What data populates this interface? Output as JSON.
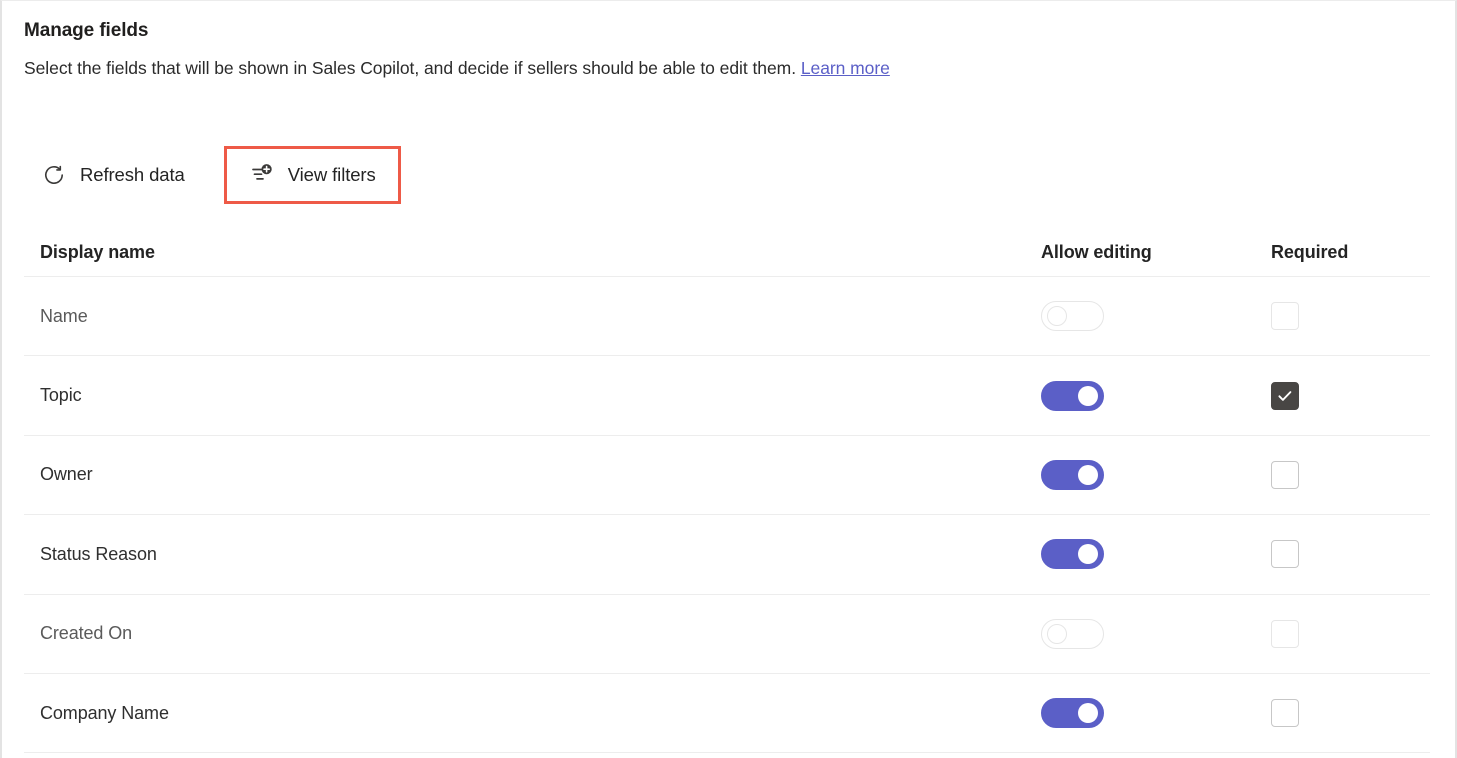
{
  "header": {
    "title": "Manage fields",
    "description_before_link": "Select the fields that will be shown in Sales Copilot, and decide if sellers should be able to edit them. ",
    "link_label": "Learn more"
  },
  "toolbar": {
    "refresh_label": "Refresh data",
    "refresh_icon": "refresh-icon",
    "view_filters_label": "View filters",
    "view_filters_icon": "filter-add-icon",
    "highlight_color": "#ee5a47"
  },
  "table": {
    "columns": [
      {
        "key": "display_name",
        "label": "Display name"
      },
      {
        "key": "allow_editing",
        "label": "Allow editing"
      },
      {
        "key": "required",
        "label": "Required"
      }
    ],
    "rows": [
      {
        "display_name": "Name",
        "allow_editing": "off",
        "required": "unchecked",
        "disabled": true
      },
      {
        "display_name": "Topic",
        "allow_editing": "on",
        "required": "checked",
        "disabled": false
      },
      {
        "display_name": "Owner",
        "allow_editing": "on",
        "required": "unchecked",
        "disabled": false
      },
      {
        "display_name": "Status Reason",
        "allow_editing": "on",
        "required": "unchecked",
        "disabled": false
      },
      {
        "display_name": "Created On",
        "allow_editing": "off",
        "required": "unchecked",
        "disabled": true
      },
      {
        "display_name": "Company Name",
        "allow_editing": "on",
        "required": "unchecked",
        "disabled": false
      }
    ]
  },
  "colors": {
    "toggle_on": "#5b5fc7",
    "checkbox_checked": "#484644",
    "link": "#5b5fc7",
    "highlight": "#ee5a47"
  }
}
